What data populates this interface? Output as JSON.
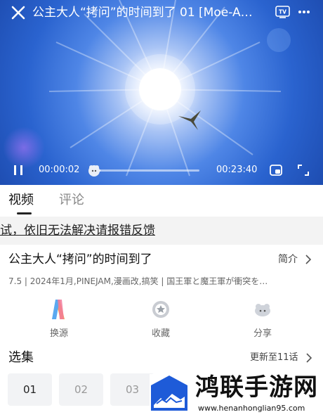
{
  "player": {
    "title": "公主大人“拷问”的时间到了 01 [Moe-A…",
    "current_time": "00:00:02",
    "total_time": "00:23:40",
    "progress_fraction": 0.0014,
    "icons": {
      "close": "close-icon",
      "tv": "tv-cast-icon",
      "more": "more-dots-icon",
      "pause": "pause-icon",
      "pip": "picture-in-picture-icon",
      "fullscreen": "fullscreen-icon"
    },
    "tv_badge": "TV"
  },
  "tabs": [
    {
      "label": "视频",
      "active": true
    },
    {
      "label": "评论",
      "active": false
    }
  ],
  "notice": "试，依旧无法解决请报错反馈",
  "info": {
    "title": "公主大人“拷问”的时间到了",
    "intro_label": "简介",
    "meta": "7.5 | 2024年1月,PINEJAM,漫画改,搞笑 | 国王軍と魔王軍が衝突を…"
  },
  "actions": [
    {
      "label": "换源",
      "icon": "switch-source-icon"
    },
    {
      "label": "收藏",
      "icon": "favorite-icon"
    },
    {
      "label": "分享",
      "icon": "share-icon"
    }
  ],
  "episodes": {
    "title": "选集",
    "update_label": "更新至11话",
    "items": [
      "01",
      "02",
      "03"
    ],
    "selected": "01"
  },
  "watermark": {
    "title": "鸿联手游网",
    "url": "www.henanhonglian95.com"
  },
  "colors": {
    "accent_text": "#222222",
    "muted_text": "#888888",
    "sky_blue": "#2a63cf",
    "episode_bg": "#f2f3f5",
    "logo_blue": "#1e5bd8"
  }
}
